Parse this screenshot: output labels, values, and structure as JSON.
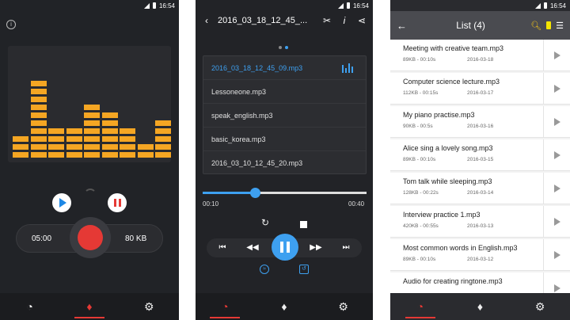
{
  "status": {
    "time": "16:54"
  },
  "recorder": {
    "info_icon": "i",
    "time": "05:00",
    "size": "80 KB",
    "accent": "#f5a623",
    "eq_levels": [
      3,
      10,
      4,
      4,
      7,
      6,
      4,
      2,
      5
    ],
    "nav": [
      {
        "icon": "speedometer-icon",
        "glyph": "◔"
      },
      {
        "icon": "microphone-icon",
        "glyph": "🎙"
      },
      {
        "icon": "gear-icon",
        "glyph": "⚙"
      }
    ]
  },
  "player": {
    "title": "2016_03_18_12_45_...",
    "files": [
      "2016_03_18_12_45_09.mp3",
      "Lessoneone.mp3",
      "speak_english.mp3",
      "basic_korea.mp3",
      "2016_03_10_12_45_20.mp3"
    ],
    "current_time": "00:10",
    "total_time": "00:40",
    "progress": 0.32,
    "accent": "#3ea0f0"
  },
  "list": {
    "title": "List (4)",
    "items": [
      {
        "name": "Meeting with creative team.mp3",
        "meta": "89KB - 00:10s",
        "date": "2016-03-18"
      },
      {
        "name": "Computer science lecture.mp3",
        "meta": "112KB - 00:15s",
        "date": "2016-03-17"
      },
      {
        "name": "My piano practise.mp3",
        "meta": "90KB - 00:5s",
        "date": "2016-03-16"
      },
      {
        "name": "Alice sing a lovely song.mp3",
        "meta": "89KB - 00:10s",
        "date": "2016-03-15"
      },
      {
        "name": "Tom talk while sleeping.mp3",
        "meta": "128KB - 00:22s",
        "date": "2016-03-14"
      },
      {
        "name": "Interview practice 1.mp3",
        "meta": "420KB - 00:55s",
        "date": "2016-03-13"
      },
      {
        "name": "Most common words in English.mp3",
        "meta": "89KB - 00:10s",
        "date": "2016-03-12"
      },
      {
        "name": "Audio for creating ringtone.mp3",
        "meta": "",
        "date": ""
      }
    ]
  }
}
